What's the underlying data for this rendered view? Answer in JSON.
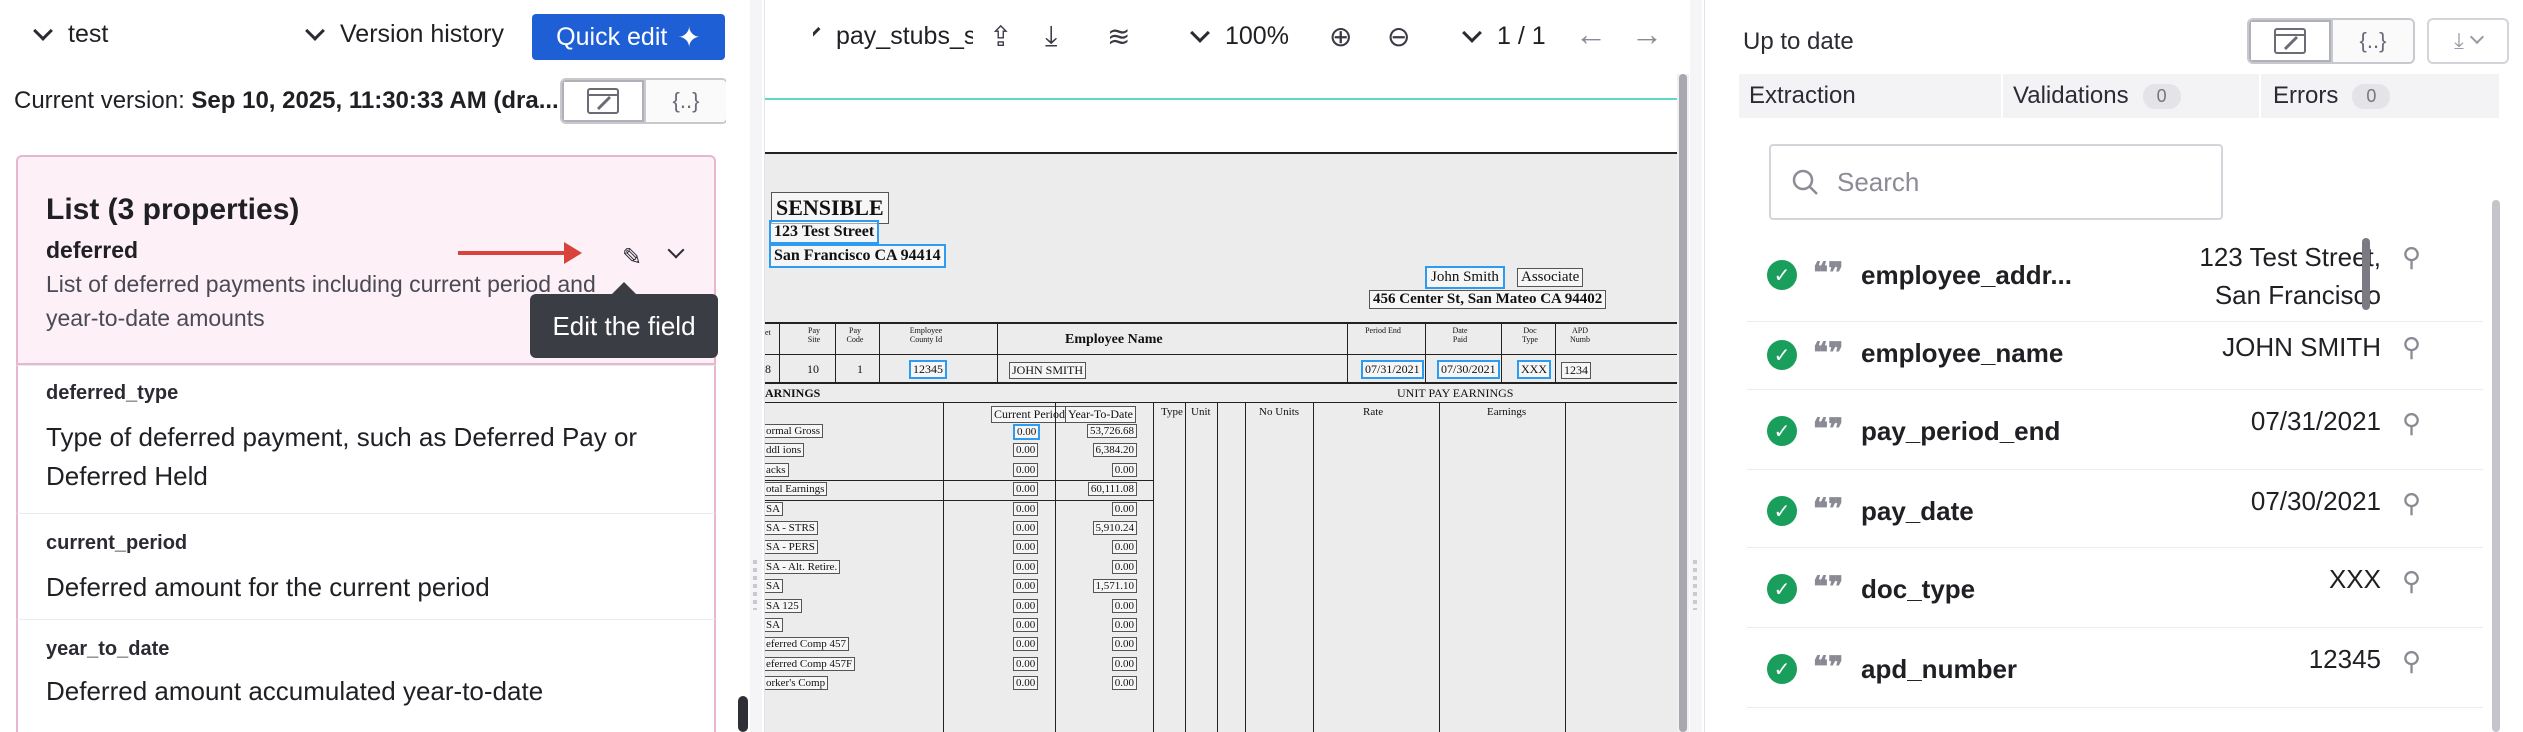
{
  "left": {
    "project": "test",
    "version_history": "Version history",
    "quick_edit": "Quick edit",
    "current_version_label": "Current version:",
    "current_version_value": "Sep 10, 2025, 11:30:33 AM (dra...",
    "card": {
      "title": "List (3 properties)",
      "name": "deferred",
      "description": "List of deferred payments including current period and year-to-date amounts",
      "tooltip": "Edit the field"
    },
    "properties": [
      {
        "name": "deferred_type",
        "description": "Type of deferred payment, such as Deferred Pay or Deferred Held"
      },
      {
        "name": "current_period",
        "description": "Deferred amount for the current period"
      },
      {
        "name": "year_to_date",
        "description": "Deferred amount accumulated year-to-date"
      }
    ]
  },
  "middle": {
    "file_name": "pay_stubs_s",
    "zoom": "100%",
    "page": "1 / 1",
    "doc": {
      "company": "SENSIBLE",
      "street": "123 Test Street",
      "city": "San Francisco CA 94414",
      "employee": "John Smith",
      "role": "Associate",
      "emp_address": "456 Center St, San Mateo CA 94402",
      "col_employee_name": "Employee Name",
      "col_period_end": "Period End",
      "col_date_paid": "Date Paid",
      "col_doc_type": "Doc Type",
      "col_apd": "APD Numb",
      "col_pay_site": "Pay Site",
      "col_pay_code": "Pay Code",
      "col_county": "Employee County Id",
      "col_et": "et",
      "r_8": "8",
      "r_10": "10",
      "r_1": "1",
      "r_county": "12345",
      "r_name": "JOHN SMITH",
      "r_period_end": "07/31/2021",
      "r_date_paid": "07/30/2021",
      "r_doc_type": "XXX",
      "r_apd": "1234",
      "earnings": "ARNINGS",
      "unit_pay": "UNIT PAY EARNINGS",
      "current_period": "Current Period",
      "ytd": "Year-To-Date",
      "unit_cols": [
        "Type",
        "Unit",
        "No Units",
        "Rate",
        "Earnings"
      ],
      "lines": [
        {
          "label": "ormal Gross",
          "cur": "0.00",
          "ytd": "53,726.68"
        },
        {
          "label": "ddl ions",
          "cur": "0.00",
          "ytd": "6,384.20"
        },
        {
          "label": "acks",
          "cur": "0.00",
          "ytd": "0.00"
        },
        {
          "label": "otal Earnings",
          "cur": "0.00",
          "ytd": "60,111.08"
        },
        {
          "label": "SA",
          "cur": "0.00",
          "ytd": "0.00"
        },
        {
          "label": "SA - STRS",
          "cur": "0.00",
          "ytd": "5,910.24"
        },
        {
          "label": "SA - PERS",
          "cur": "0.00",
          "ytd": "0.00"
        },
        {
          "label": "SA - Alt. Retire.",
          "cur": "0.00",
          "ytd": "0.00"
        },
        {
          "label": "SA",
          "cur": "0.00",
          "ytd": "1,571.10"
        },
        {
          "label": "SA 125",
          "cur": "0.00",
          "ytd": "0.00"
        },
        {
          "label": "SA",
          "cur": "0.00",
          "ytd": "0.00"
        },
        {
          "label": "eferred Comp 457",
          "cur": "0.00",
          "ytd": "0.00"
        },
        {
          "label": "eferred Comp 457F",
          "cur": "0.00",
          "ytd": "0.00"
        },
        {
          "label": "orker's Comp",
          "cur": "0.00",
          "ytd": "0.00"
        }
      ]
    }
  },
  "right": {
    "status": "Up to date",
    "tabs": [
      {
        "label": "Extraction",
        "count": ""
      },
      {
        "label": "Validations",
        "count": "0"
      },
      {
        "label": "Errors",
        "count": "0"
      }
    ],
    "search_placeholder": "Search",
    "fields": [
      {
        "name": "employee_addr...",
        "value": "123 Test Street, San Francisco"
      },
      {
        "name": "employee_name",
        "value": "JOHN SMITH"
      },
      {
        "name": "pay_period_end",
        "value": "07/31/2021"
      },
      {
        "name": "pay_date",
        "value": "07/30/2021"
      },
      {
        "name": "doc_type",
        "value": "XXX"
      },
      {
        "name": "apd_number",
        "value": "12345"
      }
    ]
  }
}
